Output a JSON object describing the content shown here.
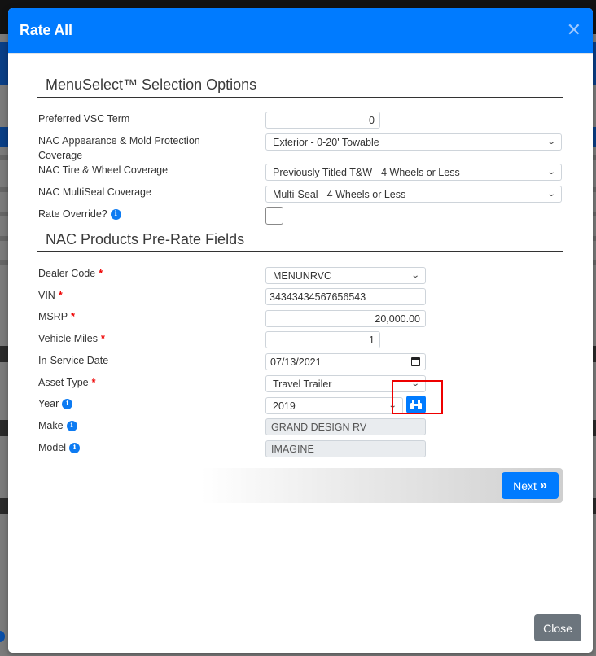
{
  "modal": {
    "title": "Rate All",
    "close_icon": "close-x-icon"
  },
  "sections": {
    "menuselect_title": "MenuSelect™ Selection Options",
    "nac_title": "NAC Products Pre-Rate Fields"
  },
  "menuselect": {
    "preferred_vsc_term": {
      "label": "Preferred VSC Term",
      "value": "0"
    },
    "appearance_coverage": {
      "label": "NAC Appearance & Mold Protection Coverage",
      "value": "Exterior - 0-20' Towable"
    },
    "tire_wheel_coverage": {
      "label": "NAC Tire & Wheel Coverage",
      "value": "Previously Titled T&W - 4 Wheels or Less"
    },
    "multiseal_coverage": {
      "label": "NAC MultiSeal Coverage",
      "value": "Multi-Seal - 4 Wheels or Less"
    },
    "rate_override": {
      "label": "Rate Override?",
      "checked": false,
      "info_icon": "info-icon"
    }
  },
  "nac": {
    "dealer_code": {
      "label": "Dealer Code",
      "required": "*",
      "value": "MENUNRVC"
    },
    "vin": {
      "label": "VIN",
      "required": "*",
      "value": "34343434567656543"
    },
    "msrp": {
      "label": "MSRP",
      "required": "*",
      "value": "20,000.00"
    },
    "vehicle_miles": {
      "label": "Vehicle Miles",
      "required": "*",
      "value": "1"
    },
    "in_service_date": {
      "label": "In-Service Date",
      "value": "07/13/2021"
    },
    "asset_type": {
      "label": "Asset Type",
      "required": "*",
      "value": "Travel Trailer"
    },
    "year": {
      "label": "Year",
      "value": "2019"
    },
    "make": {
      "label": "Make",
      "value": "GRAND DESIGN RV"
    },
    "model": {
      "label": "Model",
      "value": "IMAGINE"
    }
  },
  "buttons": {
    "next": "Next",
    "next_icon": "»",
    "close": "Close"
  },
  "colors": {
    "primary": "#007bff",
    "secondary": "#6c757d",
    "required": "#ee0000",
    "highlight": "#ee0000"
  }
}
